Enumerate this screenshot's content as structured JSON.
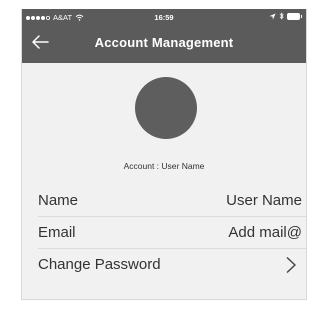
{
  "status_bar": {
    "carrier": "A&AT",
    "time": "16:59",
    "signal_icon": "signal-dots-icon",
    "wifi_icon": "wifi-icon",
    "location_icon": "location-arrow-icon",
    "bluetooth_icon": "bluetooth-icon",
    "battery_icon": "battery-icon"
  },
  "header": {
    "title": "Account Management",
    "back_icon": "arrow-left-icon",
    "background_color": "#5b5b5b"
  },
  "profile": {
    "avatar_color": "#5e5e5e",
    "account_caption": "Account : User Name"
  },
  "rows": [
    {
      "label": "Name",
      "value": "User Name"
    },
    {
      "label": "Email",
      "value": "Add mail@"
    },
    {
      "label": "Change Password",
      "icon": "chevron-right-icon"
    }
  ]
}
